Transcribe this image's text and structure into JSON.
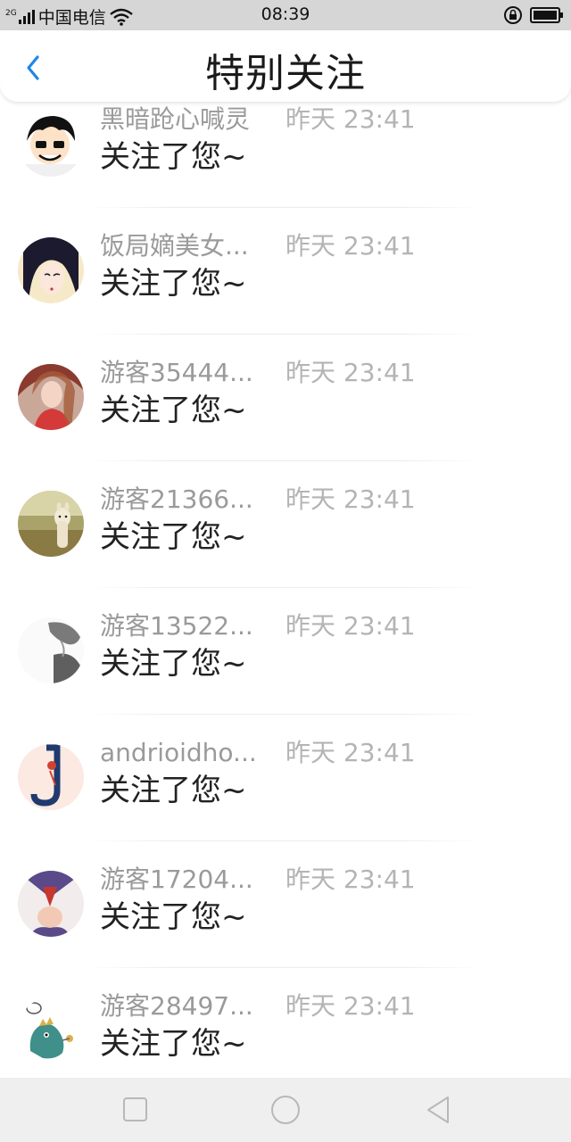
{
  "status_bar": {
    "network_type": "2G",
    "carrier": "中国电信",
    "time": "08:39",
    "icons": [
      "signal-icon",
      "wifi-icon",
      "rotation-lock-icon",
      "battery-icon"
    ]
  },
  "header": {
    "title": "特别关注",
    "back_icon": "chevron-left-icon",
    "accent_color": "#1e88e5"
  },
  "notifications": [
    {
      "username": "黑暗跄心喊灵",
      "time": "昨天 23:41",
      "message": "关注了您~",
      "avatar": "cartoon-boy-avatar"
    },
    {
      "username": "饭局嫡美女...",
      "time": "昨天 23:41",
      "message": "关注了您~",
      "avatar": "anime-girl-avatar"
    },
    {
      "username": "游客35444...",
      "time": "昨天 23:41",
      "message": "关注了您~",
      "avatar": "woman-photo-avatar"
    },
    {
      "username": "游客21366...",
      "time": "昨天 23:41",
      "message": "关注了您~",
      "avatar": "alpaca-avatar"
    },
    {
      "username": "游客13522...",
      "time": "昨天 23:41",
      "message": "关注了您~",
      "avatar": "grayscale-portrait-avatar"
    },
    {
      "username": "andrioidho...",
      "time": "昨天 23:41",
      "message": "关注了您~",
      "avatar": "letter-j-illustration-avatar"
    },
    {
      "username": "游客17204...",
      "time": "昨天 23:41",
      "message": "关注了您~",
      "avatar": "sailor-uniform-avatar"
    },
    {
      "username": "游客28497...",
      "time": "昨天 23:41",
      "message": "关注了您~",
      "avatar": "cartoon-dinosaur-avatar"
    }
  ],
  "nav_bar": {
    "buttons": [
      "recents-square-icon",
      "home-circle-icon",
      "back-triangle-icon"
    ]
  }
}
